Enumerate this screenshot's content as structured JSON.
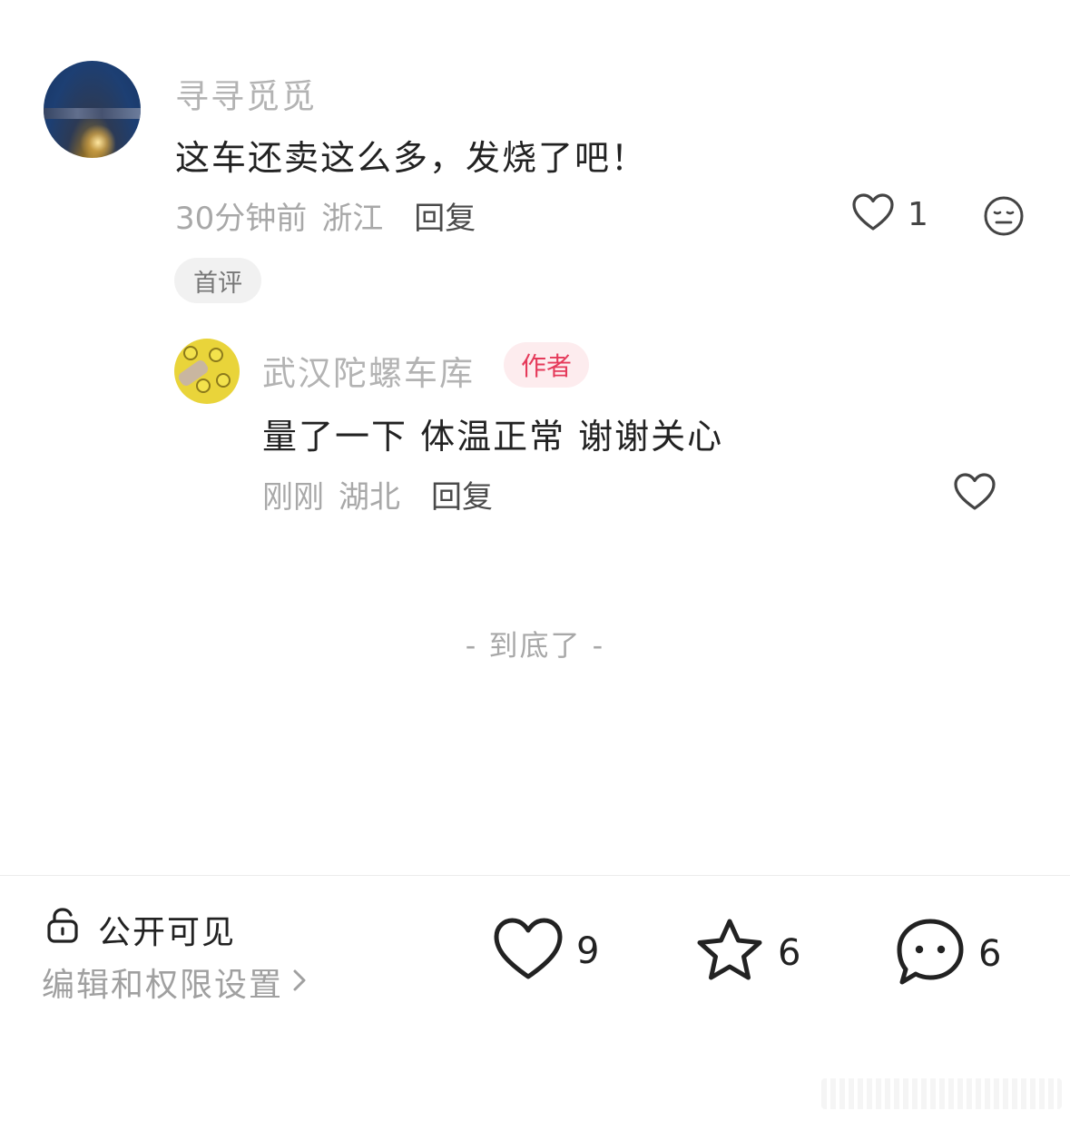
{
  "comment": {
    "username": "寻寻觅觅",
    "text": "这车还卖这么多，发烧了吧！",
    "time": "30分钟前",
    "location": "浙江",
    "reply_label": "回复",
    "like_count": "1",
    "badge": "首评",
    "icons": {
      "like": "heart-outline-icon",
      "emoji": "neutral-face-icon"
    }
  },
  "reply": {
    "username": "武汉陀螺车库",
    "author_badge": "作者",
    "text": "量了一下 体温正常 谢谢关心",
    "time": "刚刚",
    "location": "湖北",
    "reply_label": "回复",
    "icons": {
      "like": "heart-outline-icon"
    }
  },
  "end_marker": "- 到底了 -",
  "bottom_bar": {
    "visibility": "公开可见",
    "permission_link": "编辑和权限设置",
    "likes": "9",
    "favorites": "6",
    "comments": "6",
    "icons": {
      "lock": "unlock-icon",
      "like": "heart-outline-icon",
      "favorite": "star-outline-icon",
      "comment": "chat-bubble-icon",
      "chevron": "chevron-right-icon"
    }
  },
  "colors": {
    "text_primary": "#222222",
    "text_secondary": "#a8a8a8",
    "author_badge_bg": "#fdecee",
    "author_badge_text": "#e53a5a"
  }
}
